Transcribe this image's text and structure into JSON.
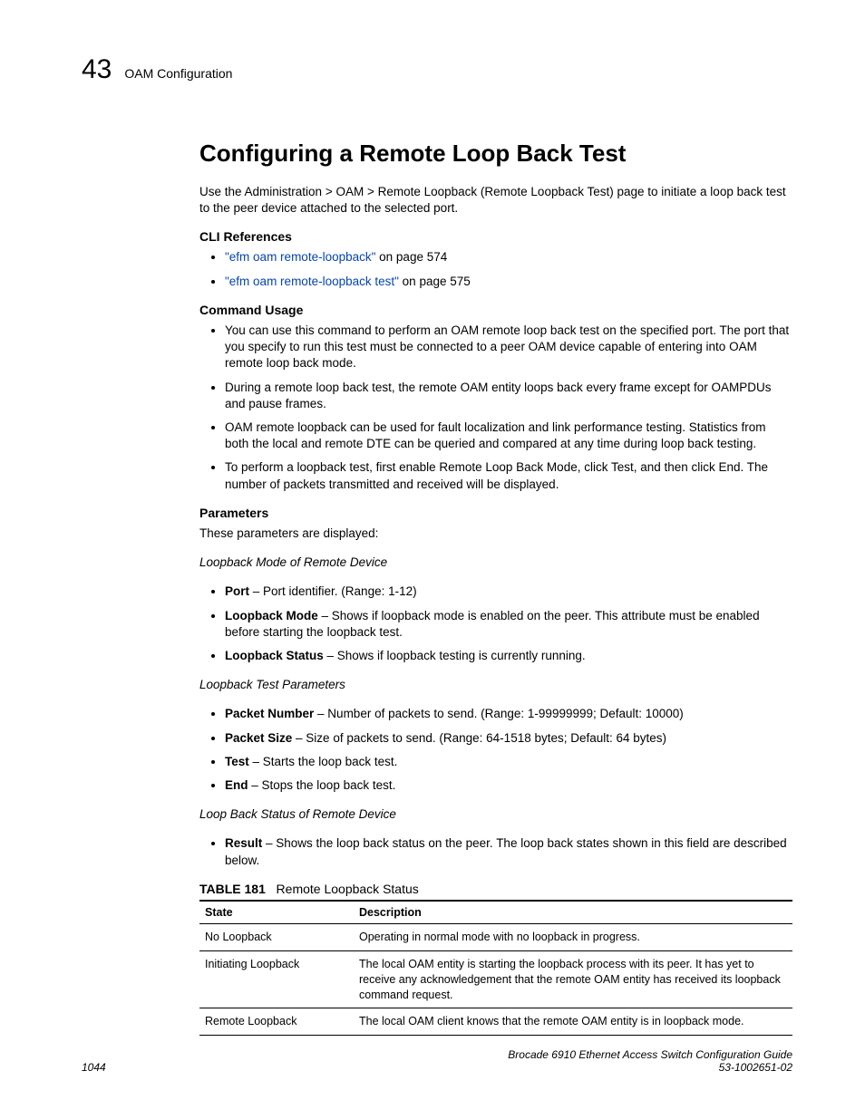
{
  "runhead": {
    "chapnum": "43",
    "chaptitle": "OAM Configuration"
  },
  "h1": "Configuring a Remote Loop Back Test",
  "intro": "Use the Administration > OAM > Remote Loopback (Remote Loopback Test) page to initiate a loop back test to the peer device attached to the selected port.",
  "cli": {
    "head": "CLI References",
    "items": [
      {
        "link": "\"efm oam remote-loopback\"",
        "after": " on page 574"
      },
      {
        "link": "\"efm oam remote-loopback test\"",
        "after": " on page 575"
      }
    ]
  },
  "usage": {
    "head": "Command Usage",
    "items": [
      "You can use this command to perform an OAM remote loop back test on the specified port. The port that you specify to run this test must be connected to a peer OAM device capable of entering into OAM remote loop back mode.",
      "During a remote loop back test, the remote OAM entity loops back every frame except for OAMPDUs and pause frames.",
      "OAM remote loopback can be used for fault localization and link performance testing. Statistics from both the local and remote DTE can be queried and compared at any time during loop back testing.",
      "To perform a loopback test, first enable Remote Loop Back Mode, click Test, and then click End. The number of packets transmitted and received will be displayed."
    ]
  },
  "params": {
    "head": "Parameters",
    "lede": "These parameters are displayed:",
    "grp1_title": "Loopback Mode of Remote Device",
    "grp1": [
      {
        "b": "Port",
        "t": " – Port identifier. (Range: 1-12)"
      },
      {
        "b": "Loopback Mode",
        "t": " – Shows if loopback mode is enabled on the peer. This attribute must be enabled before starting the loopback test."
      },
      {
        "b": "Loopback Status",
        "t": " – Shows if loopback testing is currently running."
      }
    ],
    "grp2_title": "Loopback Test Parameters",
    "grp2": [
      {
        "b": "Packet Number",
        "t": " – Number of packets to send. (Range: 1-99999999; Default: 10000)"
      },
      {
        "b": "Packet Size",
        "t": " – Size of packets to send. (Range: 64-1518 bytes; Default: 64 bytes)"
      },
      {
        "b": "Test",
        "t": " – Starts the loop back test."
      },
      {
        "b": "End",
        "t": " – Stops the loop back test."
      }
    ],
    "grp3_title": "Loop Back Status of Remote Device",
    "grp3": [
      {
        "b": "Result",
        "t": " – Shows the loop back status on the peer. The loop back states shown in this field are described below."
      }
    ]
  },
  "table": {
    "caption_lbl": "TABLE 181",
    "caption_txt": "Remote Loopback Status",
    "head": {
      "c1": "State",
      "c2": "Description"
    },
    "rows": [
      {
        "c1": "No Loopback",
        "c2": "Operating in normal mode with no loopback in progress."
      },
      {
        "c1": "Initiating Loopback",
        "c2": "The local OAM entity is starting the loopback process with its peer. It has yet to receive any acknowledgement that the remote OAM entity has received its loopback command request."
      },
      {
        "c1": "Remote Loopback",
        "c2": "The local OAM client knows that the remote OAM entity is in loopback mode."
      }
    ]
  },
  "footer": {
    "page": "1044",
    "book": "Brocade 6910 Ethernet Access Switch Configuration Guide",
    "docnum": "53-1002651-02"
  }
}
